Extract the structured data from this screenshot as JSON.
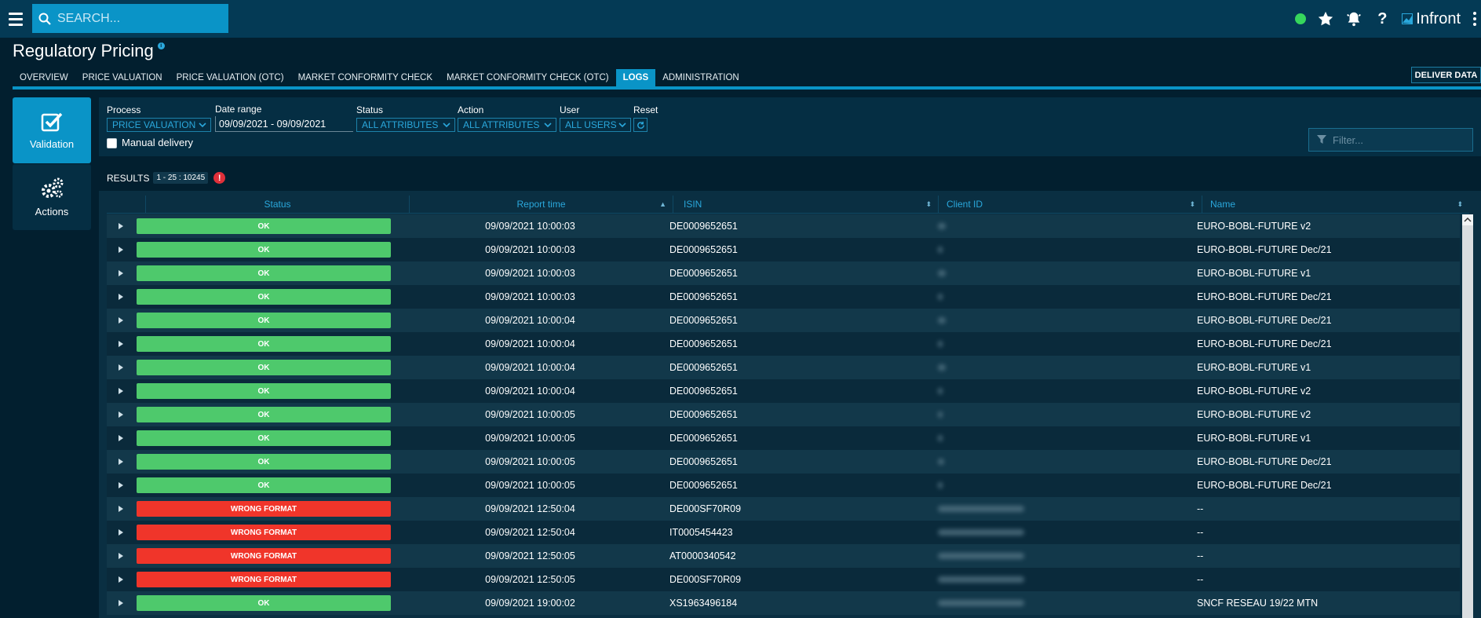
{
  "topbar": {
    "search_placeholder": "SEARCH...",
    "brand": "Infront"
  },
  "page": {
    "title": "Regulatory Pricing"
  },
  "tabs": [
    {
      "label": "OVERVIEW"
    },
    {
      "label": "PRICE VALUATION"
    },
    {
      "label": "PRICE VALUATION (OTC)"
    },
    {
      "label": "MARKET CONFORMITY CHECK"
    },
    {
      "label": "MARKET CONFORMITY CHECK (OTC)"
    },
    {
      "label": "LOGS"
    },
    {
      "label": "ADMINISTRATION"
    }
  ],
  "deliver_button": "DELIVER DATA",
  "nav": {
    "validation": "Validation",
    "actions": "Actions"
  },
  "filters": {
    "process_label": "Process",
    "process_value": "PRICE VALUATION",
    "date_label": "Date range",
    "date_value": "09/09/2021 - 09/09/2021",
    "status_label": "Status",
    "status_value": "ALL ATTRIBUTES",
    "action_label": "Action",
    "action_value": "ALL ATTRIBUTES",
    "user_label": "User",
    "user_value": "ALL USERS",
    "reset_label": "Reset",
    "manual_label": "Manual delivery",
    "filter_placeholder": "Filter..."
  },
  "results": {
    "label": "RESULTS",
    "count": "1 - 25 : 10245"
  },
  "table": {
    "columns": [
      "Status",
      "Report time",
      "ISIN",
      "Client ID",
      "Name"
    ],
    "rows": [
      {
        "status": "OK",
        "time": "09/09/2021 10:00:03",
        "isin": "DE0009652651",
        "name": "EURO-BOBL-FUTURE v2"
      },
      {
        "status": "OK",
        "time": "09/09/2021 10:00:03",
        "isin": "DE0009652651",
        "name": "EURO-BOBL-FUTURE Dec/21"
      },
      {
        "status": "OK",
        "time": "09/09/2021 10:00:03",
        "isin": "DE0009652651",
        "name": "EURO-BOBL-FUTURE v1"
      },
      {
        "status": "OK",
        "time": "09/09/2021 10:00:03",
        "isin": "DE0009652651",
        "name": "EURO-BOBL-FUTURE Dec/21"
      },
      {
        "status": "OK",
        "time": "09/09/2021 10:00:04",
        "isin": "DE0009652651",
        "name": "EURO-BOBL-FUTURE Dec/21"
      },
      {
        "status": "OK",
        "time": "09/09/2021 10:00:04",
        "isin": "DE0009652651",
        "name": "EURO-BOBL-FUTURE Dec/21"
      },
      {
        "status": "OK",
        "time": "09/09/2021 10:00:04",
        "isin": "DE0009652651",
        "name": "EURO-BOBL-FUTURE v1"
      },
      {
        "status": "OK",
        "time": "09/09/2021 10:00:04",
        "isin": "DE0009652651",
        "name": "EURO-BOBL-FUTURE v2"
      },
      {
        "status": "OK",
        "time": "09/09/2021 10:00:05",
        "isin": "DE0009652651",
        "name": "EURO-BOBL-FUTURE v2"
      },
      {
        "status": "OK",
        "time": "09/09/2021 10:00:05",
        "isin": "DE0009652651",
        "name": "EURO-BOBL-FUTURE v1"
      },
      {
        "status": "OK",
        "time": "09/09/2021 10:00:05",
        "isin": "DE0009652651",
        "name": "EURO-BOBL-FUTURE Dec/21"
      },
      {
        "status": "OK",
        "time": "09/09/2021 10:00:05",
        "isin": "DE0009652651",
        "name": "EURO-BOBL-FUTURE Dec/21"
      },
      {
        "status": "WRONG FORMAT",
        "time": "09/09/2021 12:50:04",
        "isin": "DE000SF70R09",
        "name": "--"
      },
      {
        "status": "WRONG FORMAT",
        "time": "09/09/2021 12:50:04",
        "isin": "IT0005454423",
        "name": "--"
      },
      {
        "status": "WRONG FORMAT",
        "time": "09/09/2021 12:50:05",
        "isin": "AT0000340542",
        "name": "--"
      },
      {
        "status": "WRONG FORMAT",
        "time": "09/09/2021 12:50:05",
        "isin": "DE000SF70R09",
        "name": "--"
      },
      {
        "status": "OK",
        "time": "09/09/2021 19:00:02",
        "isin": "XS1963496184",
        "name": "SNCF RESEAU 19/22 MTN"
      }
    ]
  },
  "colors": {
    "ok": "#4ec96c",
    "error": "#f0352a",
    "accent": "#0a94c7"
  }
}
